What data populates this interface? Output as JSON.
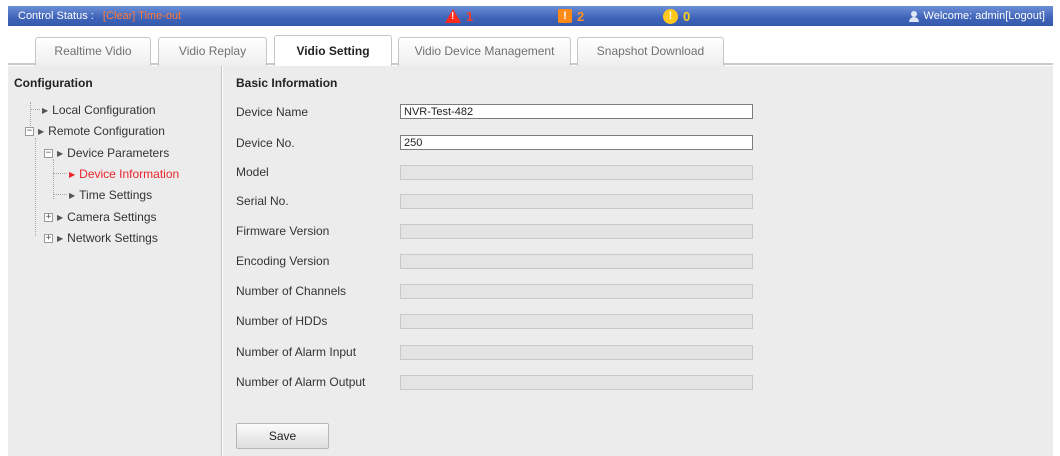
{
  "topbar": {
    "status_label": "Control Status :",
    "status_link": "[Clear] Time-out",
    "alarms": [
      {
        "icon": "warning-triangle-icon",
        "count": "1",
        "color": "#ff3a2a"
      },
      {
        "icon": "alert-square-icon",
        "count": "2",
        "color": "#ff9020"
      },
      {
        "icon": "info-circle-icon",
        "count": "0",
        "color": "#ffd21c"
      }
    ],
    "welcome": "Welcome: admin[Logout]"
  },
  "tabs": [
    {
      "label": "Realtime Vidio"
    },
    {
      "label": "Vidio Replay"
    },
    {
      "label": "Vidio Setting",
      "active": true
    },
    {
      "label": "Vidio Device Management"
    },
    {
      "label": "Snapshot Download"
    }
  ],
  "sidebar": {
    "title": "Configuration",
    "items": [
      {
        "label": "Local Configuration"
      },
      {
        "label": "Remote Configuration"
      },
      {
        "label": "Device Parameters"
      },
      {
        "label": "Device Information",
        "active": true
      },
      {
        "label": "Time Settings"
      },
      {
        "label": "Camera Settings"
      },
      {
        "label": "Network Settings"
      }
    ]
  },
  "main": {
    "title": "Basic Information",
    "fields": [
      {
        "label": "Device Name",
        "value": "NVR-Test-482",
        "editable": true
      },
      {
        "label": "Device No.",
        "value": "250",
        "editable": true
      },
      {
        "label": "Model",
        "value": ""
      },
      {
        "label": "Serial No.",
        "value": ""
      },
      {
        "label": "Firmware Version",
        "value": ""
      },
      {
        "label": "Encoding Version",
        "value": ""
      },
      {
        "label": "Number of Channels",
        "value": ""
      },
      {
        "label": "Number of HDDs",
        "value": ""
      },
      {
        "label": "Number of Alarm Input",
        "value": ""
      },
      {
        "label": "Number of Alarm Output",
        "value": ""
      }
    ],
    "save_label": "Save"
  },
  "colors": {
    "topbar": "#3f63b8",
    "status_link": "#ff7a3c",
    "active_tree_item": "#e8262b",
    "panel_bg": "#ececec"
  }
}
